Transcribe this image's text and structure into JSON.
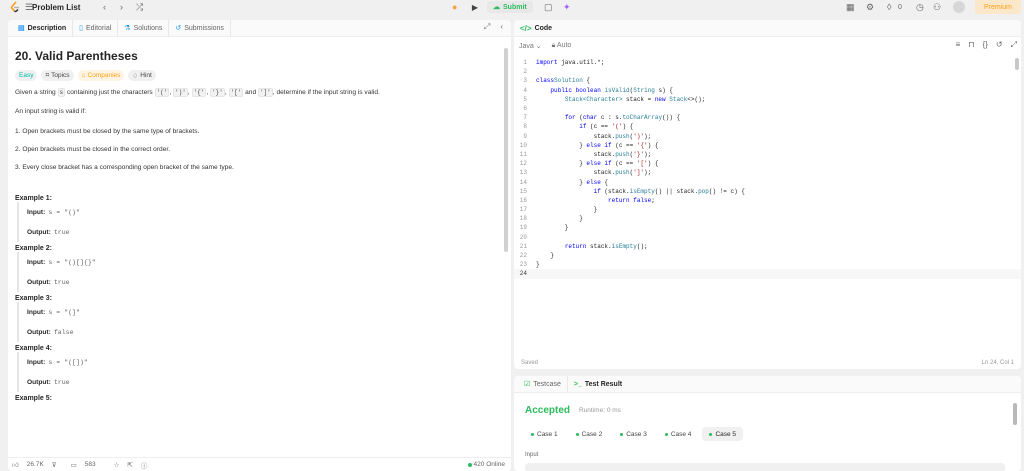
{
  "topbar": {
    "problem_list": "Problem List",
    "submit": "Submit",
    "streak": "0",
    "premium": "Premium"
  },
  "left": {
    "tabs": [
      "Description",
      "Editorial",
      "Solutions",
      "Submissions"
    ],
    "title": "20. Valid Parentheses",
    "chips": [
      "Easy",
      "Topics",
      "Companies",
      "Hint"
    ],
    "para1_pre": "Given a string ",
    "para1_s": "s",
    "para1_mid": " containing just the characters ",
    "para1_chars": [
      "'('",
      "')'",
      "'{'",
      "'}'",
      "'['"
    ],
    "para1_and": " and ",
    "para1_last": "']'",
    "para1_post": ", determine if the input string is valid.",
    "para2": "An input string is valid if:",
    "rules": [
      "1. Open brackets must be closed by the same type of brackets.",
      "2. Open brackets must be closed in the correct order.",
      "3. Every close bracket has a corresponding open bracket of the same type."
    ],
    "examples": [
      {
        "title": "Example 1:",
        "input": "s = \"()\"",
        "output": "true"
      },
      {
        "title": "Example 2:",
        "input": "s = \"()[]{}\"",
        "output": "true"
      },
      {
        "title": "Example 3:",
        "input": "s = \"(]\"",
        "output": "false"
      },
      {
        "title": "Example 4:",
        "input": "s = \"([])\"",
        "output": "true"
      }
    ],
    "example5_partial": "Example 5:",
    "input_label": "Input:",
    "output_label": "Output:",
    "footer": {
      "likes": "26.7K",
      "comments": "583",
      "online": "420 Online"
    }
  },
  "code": {
    "header": "Code",
    "language": "Java",
    "mode": "Auto",
    "saved": "Saved",
    "cursor": "Ln 24, Col 1"
  },
  "test": {
    "tabs": [
      "Testcase",
      "Test Result"
    ],
    "status": "Accepted",
    "runtime": "Runtime: 0 ms",
    "cases": [
      "Case 1",
      "Case 2",
      "Case 3",
      "Case 4",
      "Case 5"
    ],
    "input_label": "Input"
  }
}
